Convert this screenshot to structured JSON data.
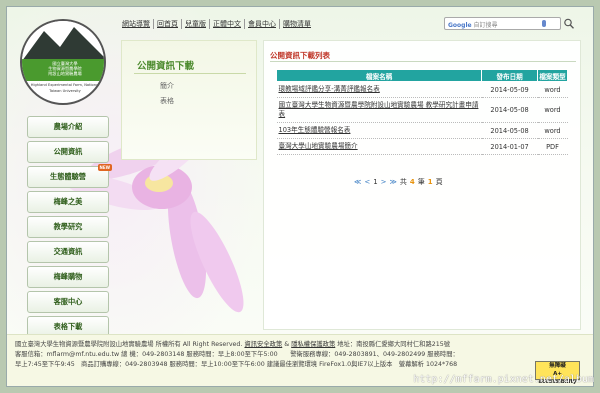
{
  "logo": {
    "line1": "國立臺灣大學",
    "line2": "生物資源暨農學院",
    "line3": "附設山地實驗農場",
    "line4": "Highland Experimental Farm, National",
    "line5": "Taiwan University"
  },
  "toplinks": [
    "網站導覽",
    "回首頁",
    "兒童版",
    "正體中文",
    "會員中心",
    "購物清單"
  ],
  "search": {
    "placeholder": "自訂搜尋",
    "brand": "Google"
  },
  "nav": [
    {
      "label": "農場介紹"
    },
    {
      "label": "公開資訊"
    },
    {
      "label": "生態體驗營",
      "badge": "NEW"
    },
    {
      "label": "梅峰之美"
    },
    {
      "label": "教學研究"
    },
    {
      "label": "交通資訊"
    },
    {
      "label": "梅峰購物"
    },
    {
      "label": "客服中心"
    },
    {
      "label": "表格下載"
    }
  ],
  "download_panel": {
    "title": "公開資訊下載",
    "links": [
      "簡介",
      "表格"
    ]
  },
  "main": {
    "title": "公開資訊下載列表",
    "columns": [
      "檔案名稱",
      "發布日期",
      "檔案類型"
    ],
    "rows": [
      {
        "name": "環教場域評鑑分享-溝菁評鑑報名表",
        "date": "2014-05-09",
        "type": "word"
      },
      {
        "name": "國立臺灣大學生物資源暨農學院附設山地實驗農場 教學研究計畫申請表",
        "date": "2014-05-08",
        "type": "word"
      },
      {
        "name": "103年生態體驗營報名表",
        "date": "2014-05-08",
        "type": "word"
      },
      {
        "name": "臺灣大學山地實驗農場簡介",
        "date": "2014-01-07",
        "type": "PDF"
      }
    ],
    "pager": {
      "prev2": "≪",
      "prev": "<",
      "current": "1",
      "next": ">",
      "next2": "≫",
      "total_pre": "共",
      "count": "4",
      "mid": "筆",
      "pages": "1",
      "total_post": "頁"
    }
  },
  "footer": {
    "line1_a": "國立臺灣大學生物資源暨農學院附設山地實驗農場 所權所有 All Right Reserved.",
    "line1_link1": "資訊安全政策",
    "line1_amp": "&",
    "line1_link2": "隱私權保護政策",
    "line1_b": "地址：南投縣仁愛鄉大同村仁和路215號",
    "line2": "客服信箱：mflarm@mf.ntu.edu.tw 總 機：049-2803148 服務時間：早上8:00至下午5:00　　警衛服務專線：049-2803891、049-2802499 服務時間：",
    "line3": "早上7:45至下午9:45　商品訂購專線：049-2803948 服務時間：早上10:00至下午6:00 建議最佳瀏覽環境 FireFox1.0與IE7以上版本　螢幕解析 1024*768",
    "badge_top": "無障礙",
    "badge_bottom": "A+ accessibility"
  },
  "watermark": "http://mffarm.pixnet.net/album"
}
